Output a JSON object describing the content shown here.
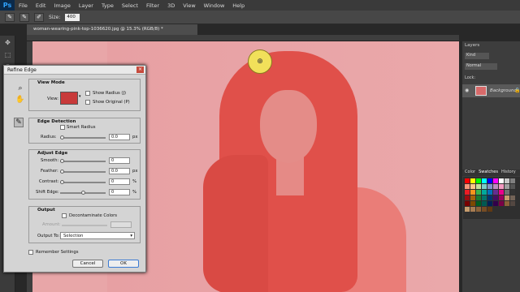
{
  "app": {
    "logo": "Ps"
  },
  "menu": [
    "File",
    "Edit",
    "Image",
    "Layer",
    "Type",
    "Select",
    "Filter",
    "3D",
    "View",
    "Window",
    "Help"
  ],
  "options": {
    "size_label": "Size:",
    "size_value": "400"
  },
  "document": {
    "tab_title": "woman-wearing-pink-top-1036620.jpg @ 15.3% (RGB/8) *"
  },
  "dialog": {
    "title": "Refine Edge",
    "view_mode": {
      "label": "View Mode",
      "view_label": "View:",
      "show_radius": "Show Radius (J)",
      "show_original": "Show Original (P)"
    },
    "edge_detection": {
      "label": "Edge Detection",
      "smart_radius": "Smart Radius",
      "radius_label": "Radius:",
      "radius_value": "0.0",
      "radius_unit": "px"
    },
    "adjust_edge": {
      "label": "Adjust Edge",
      "smooth_label": "Smooth:",
      "smooth_value": "0",
      "feather_label": "Feather:",
      "feather_value": "0.0",
      "feather_unit": "px",
      "contrast_label": "Contrast:",
      "contrast_value": "0",
      "contrast_unit": "%",
      "shift_label": "Shift Edge:",
      "shift_value": "0",
      "shift_unit": "%"
    },
    "output": {
      "label": "Output",
      "decontaminate": "Decontaminate Colors",
      "amount_label": "Amount:",
      "output_to_label": "Output To:",
      "output_to_value": "Selection"
    },
    "remember": "Remember Settings",
    "cancel": "Cancel",
    "ok": "OK"
  },
  "layers_panel": {
    "title": "Layers",
    "kind_label": "Kind",
    "blend": "Normal",
    "lock_label": "Lock:",
    "layer_name": "Background"
  },
  "color_panel": {
    "tabs": [
      "Color",
      "Swatches",
      "History"
    ]
  },
  "colors": {
    "accent": "#2fa3ff",
    "overlay": "#e0504a"
  }
}
